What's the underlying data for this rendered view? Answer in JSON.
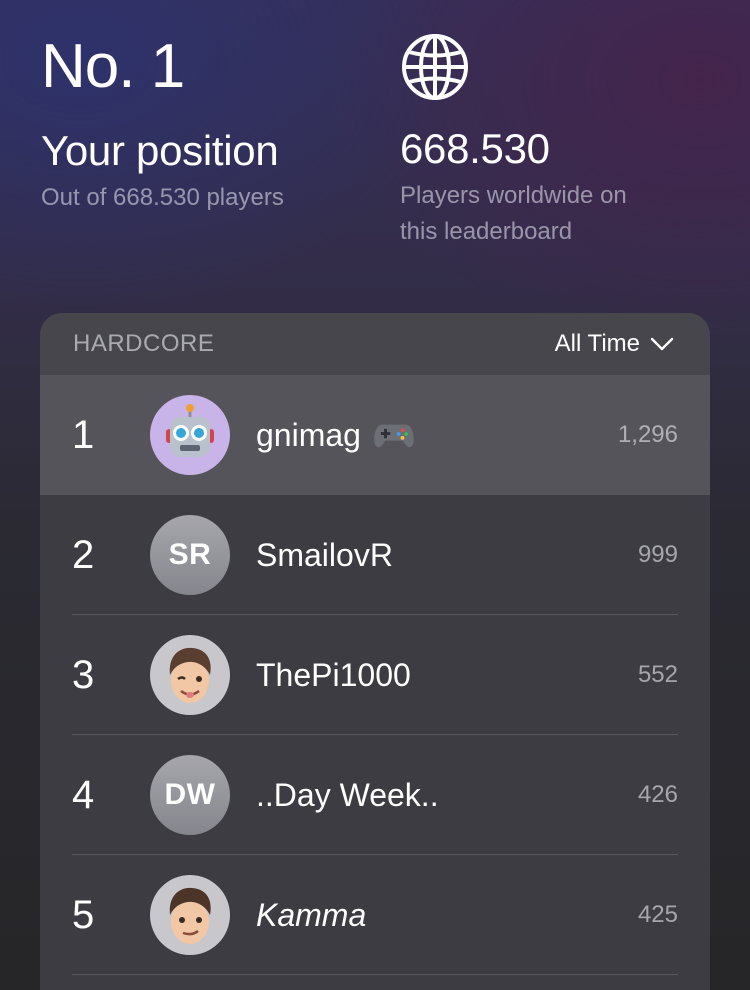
{
  "position": {
    "rank_label": "No. 1",
    "title": "Your position",
    "subtitle": "Out of 668.530 players"
  },
  "worldwide": {
    "icon": "globe-icon",
    "count": "668.530",
    "subtitle_line1": "Players worldwide on",
    "subtitle_line2": "this leaderboard"
  },
  "leaderboard": {
    "mode": "HARDCORE",
    "filter": "All Time",
    "rows": [
      {
        "rank": "1",
        "avatar": "robot-memoji",
        "name": "gnimag",
        "badge": "game-controller-icon",
        "score": "1,296",
        "highlight": true
      },
      {
        "rank": "2",
        "avatar_initials": "SR",
        "name": "SmailovR",
        "score": "999"
      },
      {
        "rank": "3",
        "avatar": "winking-memoji",
        "name": "ThePi1000",
        "score": "552"
      },
      {
        "rank": "4",
        "avatar_initials": "DW",
        "name": "..Day Week..",
        "score": "426"
      },
      {
        "rank": "5",
        "avatar": "memoji",
        "name": "Kamma",
        "score": "425"
      }
    ]
  }
}
